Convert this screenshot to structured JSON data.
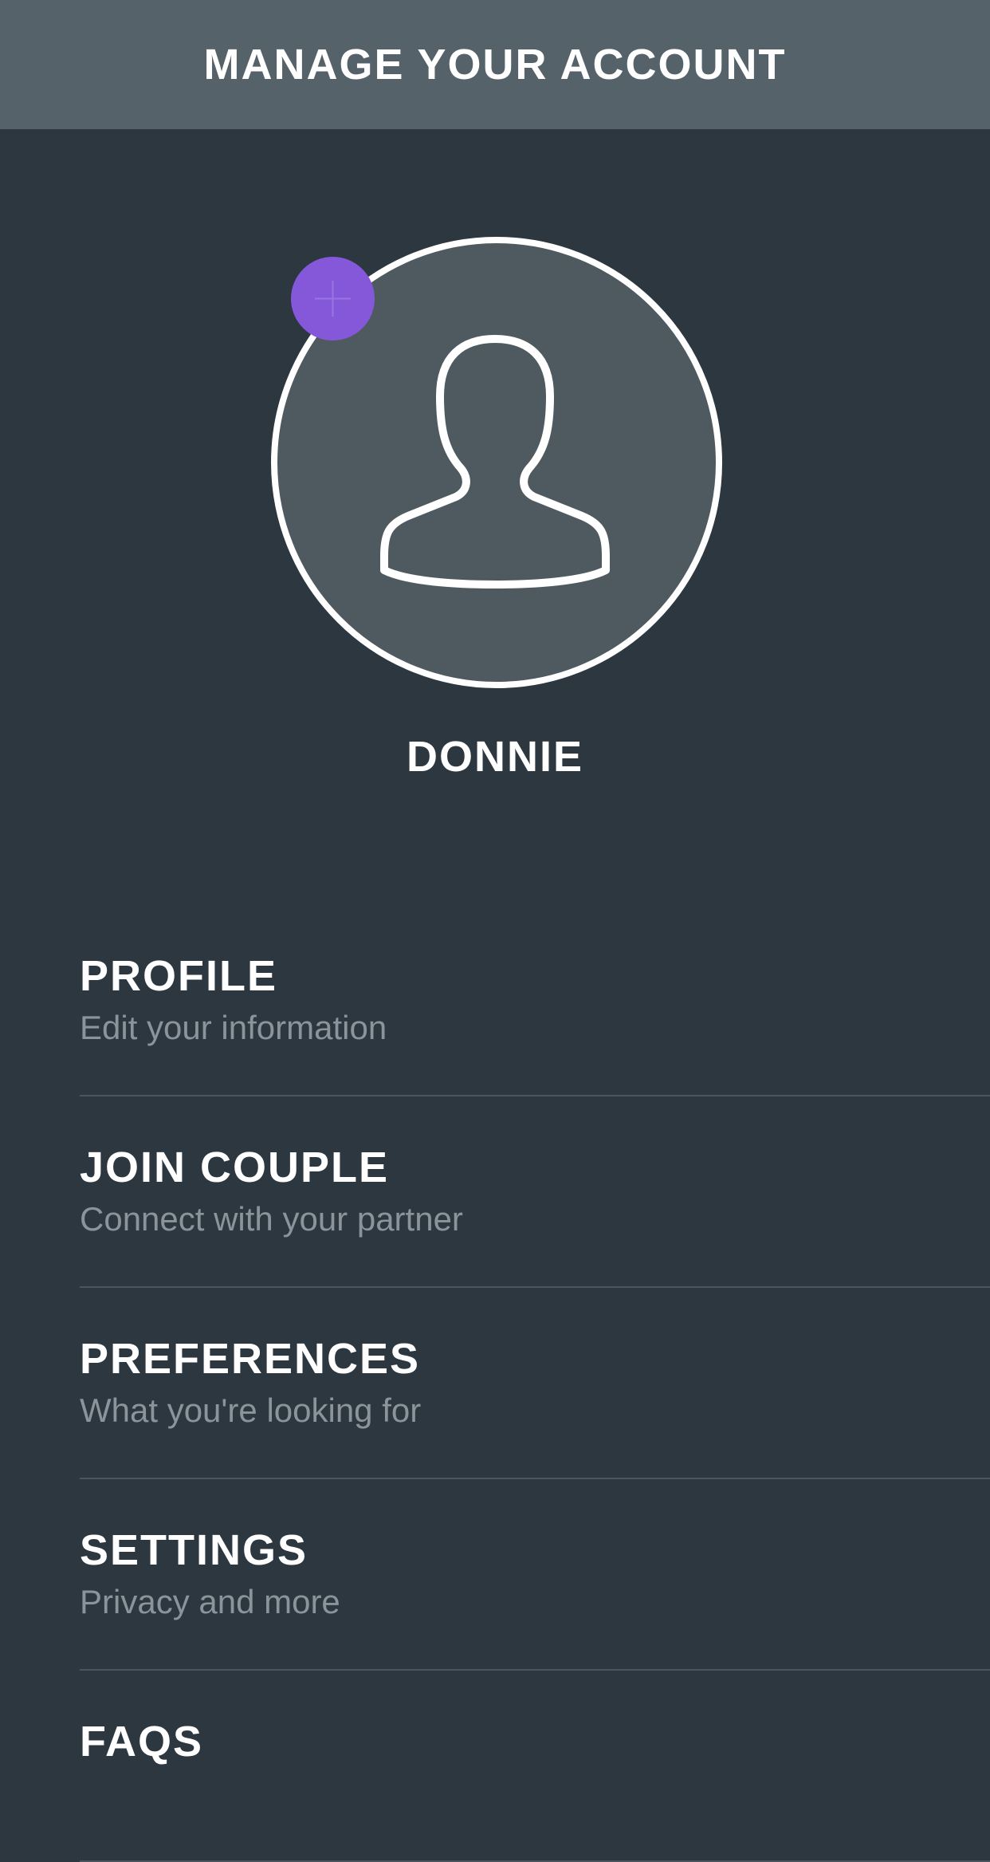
{
  "header": {
    "title": "MANAGE YOUR ACCOUNT"
  },
  "profile": {
    "name": "DONNIE",
    "subtext": "",
    "avatar_icon": "person-silhouette-icon",
    "add_photo_icon": "plus-icon"
  },
  "menu": {
    "items": [
      {
        "title": "PROFILE",
        "subtitle": "Edit your information"
      },
      {
        "title": "JOIN COUPLE",
        "subtitle": "Connect with your partner"
      },
      {
        "title": "PREFERENCES",
        "subtitle": "What you're looking for"
      },
      {
        "title": "SETTINGS",
        "subtitle": "Privacy and more"
      },
      {
        "title": "FAQS",
        "subtitle": ""
      }
    ]
  },
  "colors": {
    "background": "#2c3740",
    "header": "#56626a",
    "accent": "#8458d9",
    "subtitle": "#8a949a",
    "divider": "#4a565e"
  }
}
